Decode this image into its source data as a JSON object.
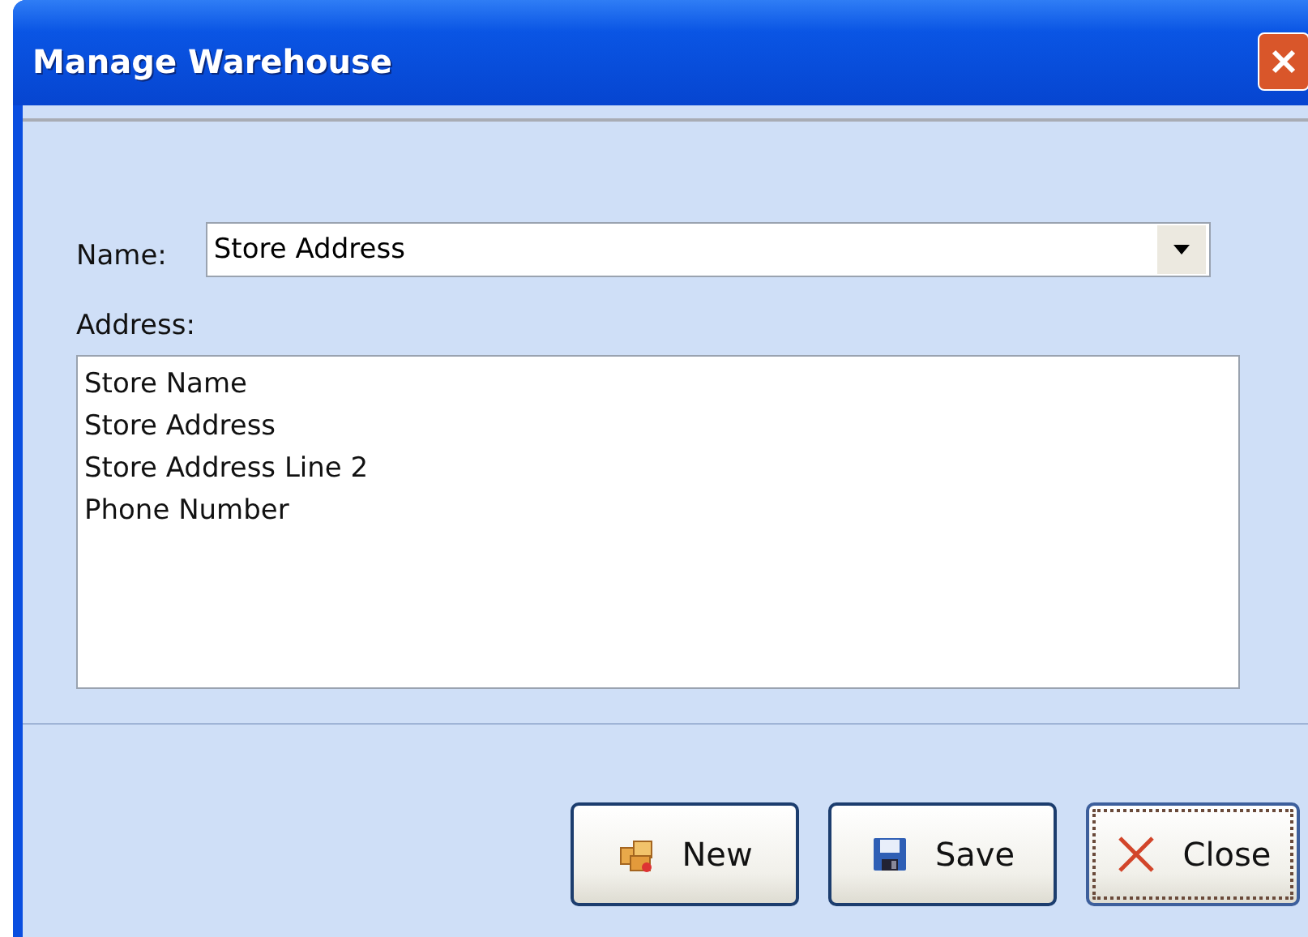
{
  "window": {
    "title": "Manage Warehouse"
  },
  "name_field": {
    "label": "Name:",
    "value": "Store Address"
  },
  "address_field": {
    "label": "Address:",
    "lines": [
      "Store Name",
      "Store Address",
      "Store Address Line 2",
      "Phone Number"
    ]
  },
  "buttons": [
    {
      "label": "New",
      "kind": "new",
      "focused": false
    },
    {
      "label": "Save",
      "kind": "save",
      "focused": false
    },
    {
      "label": "Close",
      "kind": "close",
      "focused": true
    }
  ]
}
